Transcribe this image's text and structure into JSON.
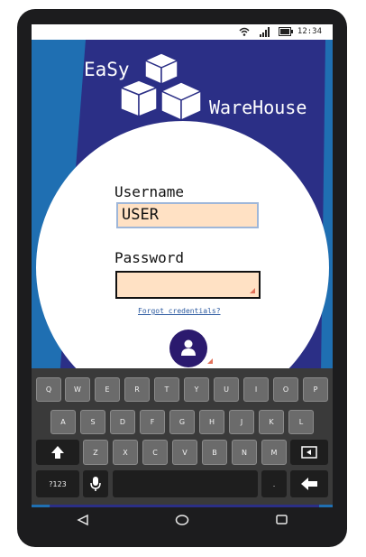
{
  "status_bar": {
    "time": "12:34",
    "icons": [
      "wifi-icon",
      "signal-icon",
      "battery-icon"
    ]
  },
  "app": {
    "name_part1": "EaSy",
    "name_part2": "WareHouse",
    "logo": "cubes-logo-icon"
  },
  "login_form": {
    "username_label": "Username",
    "username_value": "USER",
    "password_label": "Password",
    "password_value": "",
    "forgot_link": "Forgot credentials?",
    "login_button_icon": "user-icon"
  },
  "keyboard": {
    "row1": [
      "Q",
      "W",
      "E",
      "R",
      "T",
      "Y",
      "U",
      "I",
      "O",
      "P"
    ],
    "row2": [
      "A",
      "S",
      "D",
      "F",
      "G",
      "H",
      "J",
      "K",
      "L"
    ],
    "row3": [
      "Z",
      "X",
      "C",
      "V",
      "B",
      "N",
      "M"
    ],
    "symbols_key": "?123",
    "period_key": ".",
    "shift_icon": "shift-up-arrow-icon",
    "backspace_icon": "backspace-icon",
    "mic_icon": "microphone-icon",
    "enter_icon": "enter-arrow-icon"
  },
  "nav_bar": {
    "icons": [
      "back-triangle-icon",
      "home-circle-icon",
      "recent-square-icon"
    ]
  },
  "colors": {
    "screen_bg": "#2b2f86",
    "accent_blue": "#1f6fb2",
    "input_fill": "#ffe1c4",
    "login_button": "#2b1a6e"
  }
}
